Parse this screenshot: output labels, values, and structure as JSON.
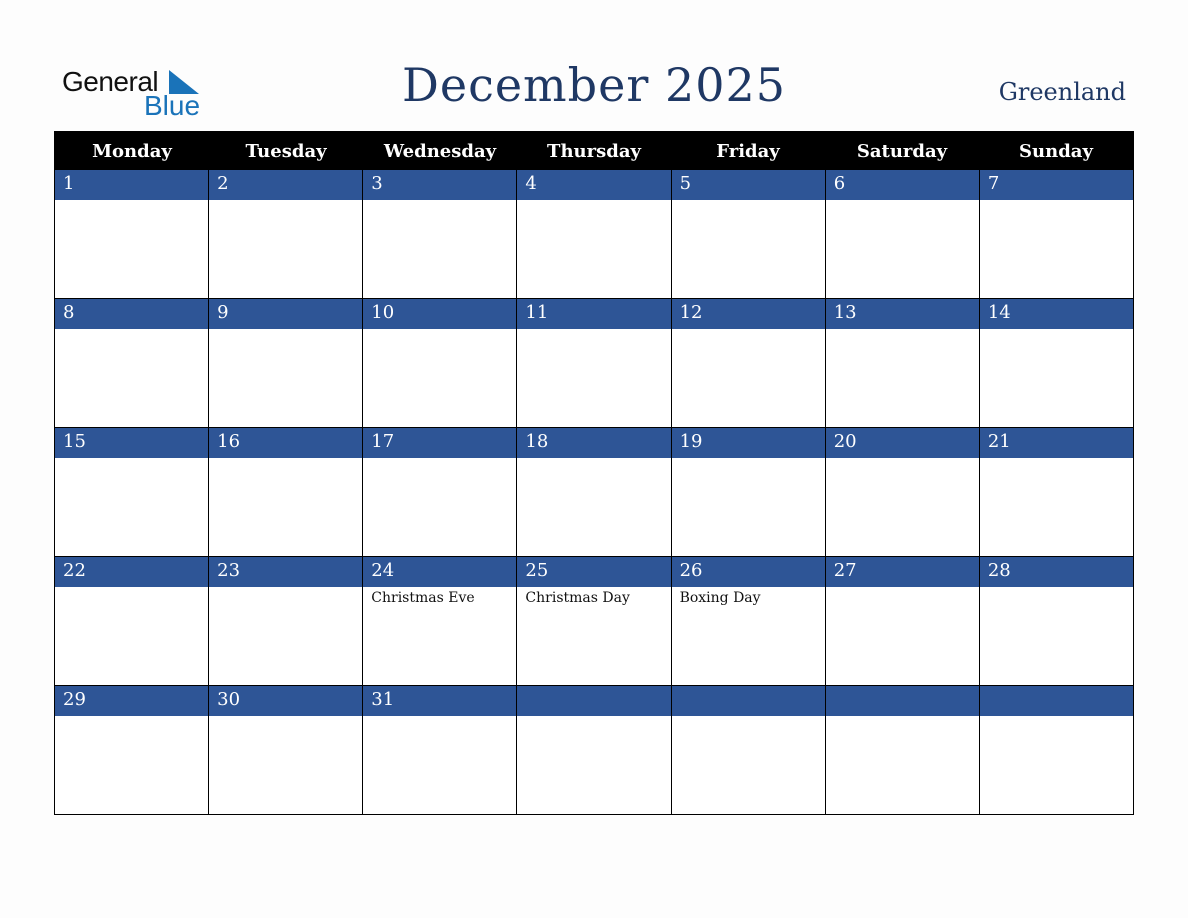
{
  "logo": {
    "general": "General",
    "blue": "Blue",
    "accent_color": "#1a73b9"
  },
  "header": {
    "title": "December 2025",
    "country": "Greenland"
  },
  "colors": {
    "title": "#1f3864",
    "day_bar": "#2e5596",
    "header_bg": "#000000"
  },
  "weekdays": [
    "Monday",
    "Tuesday",
    "Wednesday",
    "Thursday",
    "Friday",
    "Saturday",
    "Sunday"
  ],
  "weeks": [
    [
      {
        "num": "1",
        "event": ""
      },
      {
        "num": "2",
        "event": ""
      },
      {
        "num": "3",
        "event": ""
      },
      {
        "num": "4",
        "event": ""
      },
      {
        "num": "5",
        "event": ""
      },
      {
        "num": "6",
        "event": ""
      },
      {
        "num": "7",
        "event": ""
      }
    ],
    [
      {
        "num": "8",
        "event": ""
      },
      {
        "num": "9",
        "event": ""
      },
      {
        "num": "10",
        "event": ""
      },
      {
        "num": "11",
        "event": ""
      },
      {
        "num": "12",
        "event": ""
      },
      {
        "num": "13",
        "event": ""
      },
      {
        "num": "14",
        "event": ""
      }
    ],
    [
      {
        "num": "15",
        "event": ""
      },
      {
        "num": "16",
        "event": ""
      },
      {
        "num": "17",
        "event": ""
      },
      {
        "num": "18",
        "event": ""
      },
      {
        "num": "19",
        "event": ""
      },
      {
        "num": "20",
        "event": ""
      },
      {
        "num": "21",
        "event": ""
      }
    ],
    [
      {
        "num": "22",
        "event": ""
      },
      {
        "num": "23",
        "event": ""
      },
      {
        "num": "24",
        "event": "Christmas Eve"
      },
      {
        "num": "25",
        "event": "Christmas Day"
      },
      {
        "num": "26",
        "event": "Boxing Day"
      },
      {
        "num": "27",
        "event": ""
      },
      {
        "num": "28",
        "event": ""
      }
    ],
    [
      {
        "num": "29",
        "event": ""
      },
      {
        "num": "30",
        "event": ""
      },
      {
        "num": "31",
        "event": ""
      },
      {
        "num": "",
        "event": ""
      },
      {
        "num": "",
        "event": ""
      },
      {
        "num": "",
        "event": ""
      },
      {
        "num": "",
        "event": ""
      }
    ]
  ]
}
